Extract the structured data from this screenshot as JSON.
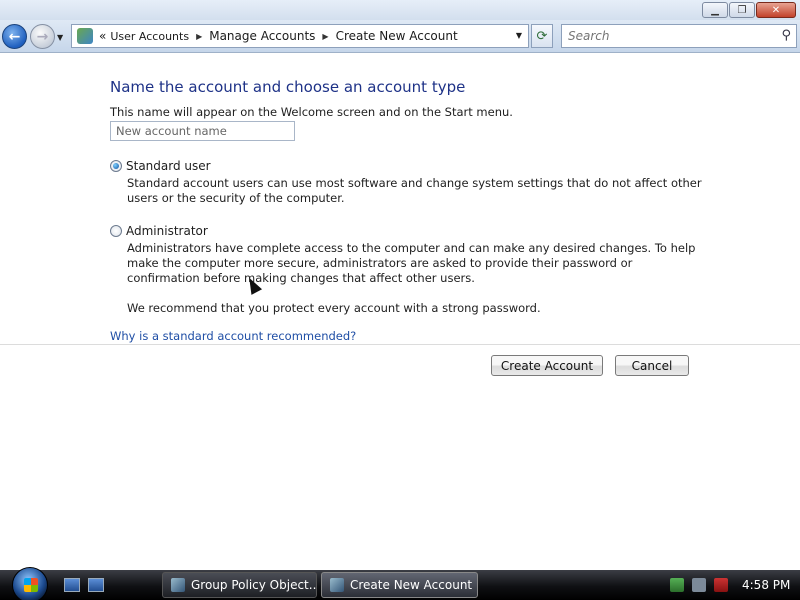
{
  "window": {
    "controls": {
      "minimize": "▁",
      "maximize": "❐",
      "close": "✕"
    }
  },
  "nav": {
    "back_glyph": "←",
    "forward_glyph": "→",
    "breadcrumb": {
      "overflow": "«",
      "items": [
        "User Accounts",
        "Manage Accounts",
        "Create New Account"
      ]
    },
    "refresh_glyph": "⟳",
    "search_placeholder": "Search",
    "search_icon": "search-icon"
  },
  "page": {
    "title": "Name the account and choose an account type",
    "subtitle": "This name will appear on the Welcome screen and on the Start menu.",
    "name_placeholder": "New account name",
    "standard": {
      "label": "Standard user",
      "selected": true,
      "description": "Standard account users can use most software and change system settings that do not affect other users or the security of the computer."
    },
    "administrator": {
      "label": "Administrator",
      "selected": false,
      "description": "Administrators have complete access to the computer and can make any desired changes. To help make the computer more secure, administrators are asked to provide their password or confirmation before making changes that affect other users."
    },
    "recommendation": "We recommend that you protect every account with a strong password.",
    "help_link": "Why is a standard account recommended?",
    "create_button": "Create Account",
    "cancel_button": "Cancel"
  },
  "taskbar": {
    "tasks": [
      "Group Policy Object...",
      "Create New Account"
    ],
    "active_task": "Create New Account",
    "clock": "4:58 PM"
  },
  "colors": {
    "heading": "#1e3287",
    "link": "#1f4ea5",
    "taskbar": "#0f1013"
  }
}
